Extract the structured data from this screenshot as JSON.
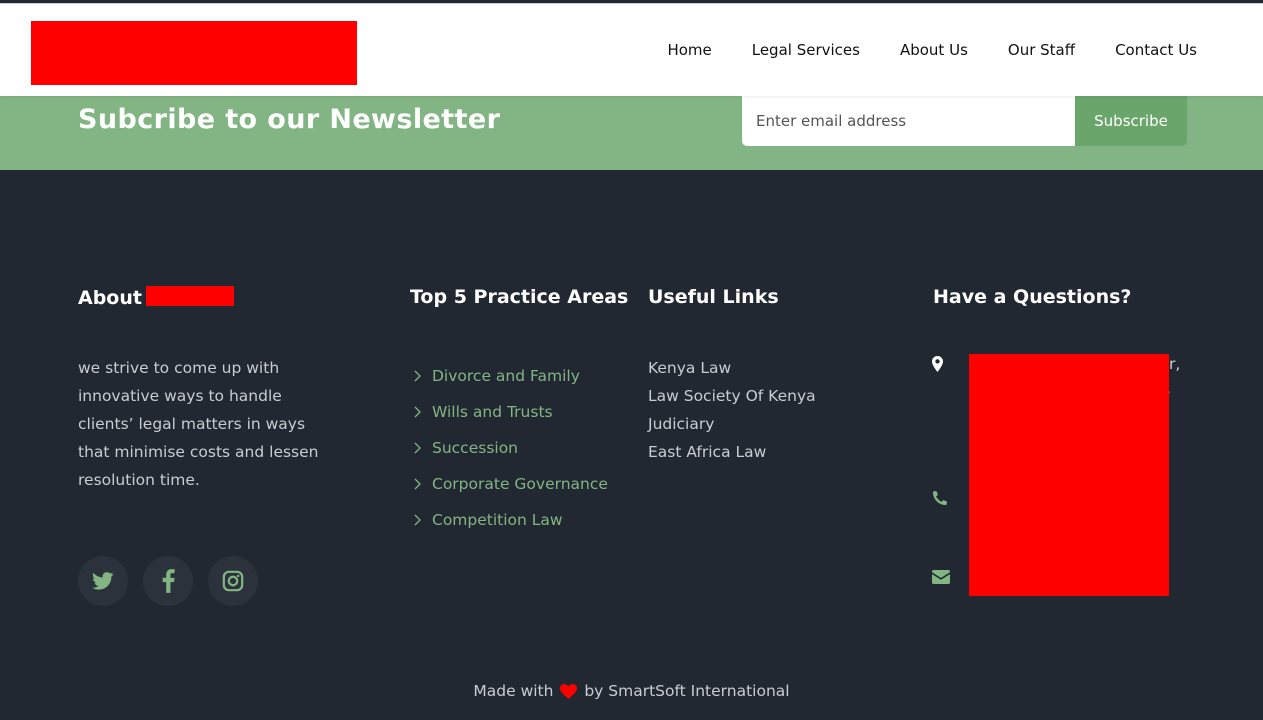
{
  "header": {
    "nav": [
      "Home",
      "Legal Services",
      "About Us",
      "Our Staff",
      "Contact Us"
    ]
  },
  "newsletter": {
    "title": "Subcribe to our Newsletter",
    "email_placeholder": "Enter email address",
    "subscribe_label": "Subscribe"
  },
  "footer": {
    "about": {
      "title": "About",
      "text": "we strive to come up with innovative ways to handle clients’ legal matters in ways that minimise costs and lessen resolution time.",
      "social_icons": [
        "twitter-icon",
        "facebook-icon",
        "instagram-icon"
      ]
    },
    "practice": {
      "title": "Top 5 Practice Areas",
      "items": [
        "Divorce and Family",
        "Wills and Trusts",
        "Succession",
        "Corporate Governance",
        "Competition Law"
      ]
    },
    "useful": {
      "title": "Useful Links",
      "items": [
        "Kenya Law",
        "Law Society Of Kenya",
        "Judiciary",
        "East Africa Law"
      ]
    },
    "questions": {
      "title": "Have a Questions?",
      "icons": [
        "map-marker-icon",
        "phone-icon",
        "envelope-icon"
      ],
      "address_peek_1": "r,",
      "address_peek_2": ","
    },
    "credit": {
      "prefix": "Made with",
      "suffix": "by SmartSoft International"
    }
  },
  "colors": {
    "accent_green": "#82b583",
    "button_green": "#6aa66b",
    "footer_bg": "#222831",
    "redaction": "#ff0000"
  }
}
